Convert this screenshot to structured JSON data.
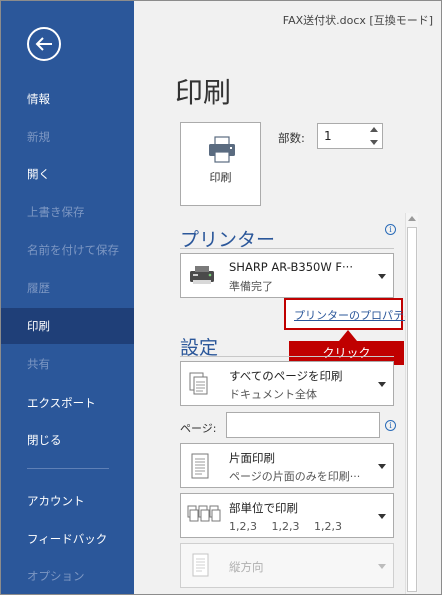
{
  "window": {
    "doc_title": "FAX送付状.docx [互換モード]"
  },
  "sidebar": {
    "items": [
      {
        "label": "情報",
        "state": "normal"
      },
      {
        "label": "新規",
        "state": "disabled"
      },
      {
        "label": "開く",
        "state": "normal"
      },
      {
        "label": "上書き保存",
        "state": "disabled"
      },
      {
        "label": "名前を付けて保存",
        "state": "disabled"
      },
      {
        "label": "履歴",
        "state": "disabled"
      },
      {
        "label": "印刷",
        "state": "active"
      },
      {
        "label": "共有",
        "state": "disabled"
      },
      {
        "label": "エクスポート",
        "state": "normal"
      },
      {
        "label": "閉じる",
        "state": "normal"
      },
      {
        "label": "アカウント",
        "state": "normal"
      },
      {
        "label": "フィードバック",
        "state": "normal"
      },
      {
        "label": "オプション",
        "state": "disabled"
      }
    ]
  },
  "main": {
    "title": "印刷",
    "print_button_label": "印刷",
    "copies_label": "部数:",
    "copies_value": "1",
    "printer_section": "プリンター",
    "printer_name": "SHARP AR-B350W F···",
    "printer_status": "準備完了",
    "printer_properties_link": "プリンターのプロパティ",
    "callout_label": "クリック",
    "settings_section": "設定",
    "settings": [
      {
        "line1": "すべてのページを印刷",
        "line2": "ドキュメント全体",
        "icon": "pages-icon"
      },
      {
        "line1": "片面印刷",
        "line2": "ページの片面のみを印刷···",
        "icon": "single-sided-icon"
      },
      {
        "line1": "部単位で印刷",
        "line2": "1,2,3　 1,2,3　 1,2,3",
        "icon": "collate-icon"
      },
      {
        "line1": "縦方向",
        "line2": "",
        "icon": "portrait-icon"
      }
    ],
    "pages_label": "ページ:",
    "pages_value": ""
  },
  "colors": {
    "sidebar_bg": "#2b579a",
    "active_bg": "#1f3f78",
    "accent": "#2b579a",
    "highlight_red": "#c00000"
  }
}
